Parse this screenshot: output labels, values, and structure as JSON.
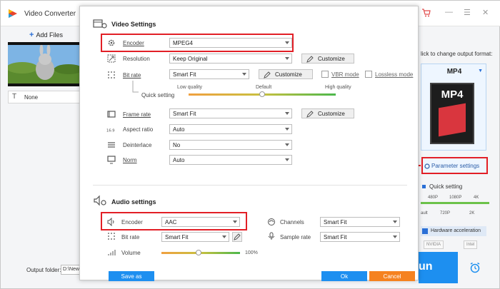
{
  "app": {
    "title": "Video Converter",
    "add_files": "Add Files",
    "file_item": "None",
    "output_folder_label": "Output folder:",
    "output_folder_value": "D:\\New fo"
  },
  "right_panel": {
    "hint": "lick to change output format:",
    "format": "MP4",
    "format_box_text": "MP4",
    "parameter_settings": "Parameter settings",
    "quick_setting": "Quick setting",
    "res_top": [
      "480P",
      "1080P",
      "4K"
    ],
    "res_bottom": [
      "ault",
      "720P",
      "2K"
    ],
    "hw_accel": "Hardware acceleration",
    "gpu_badges": [
      "NVIDIA",
      "Intel"
    ],
    "run": "un"
  },
  "video": {
    "title": "Video Settings",
    "encoder_label": "Encoder",
    "encoder_value": "MPEG4",
    "resolution_label": "Resolution",
    "resolution_value": "Keep Original",
    "customize": "Customize",
    "bitrate_label": "Bit rate",
    "bitrate_value": "Smart Fit",
    "vbr_mode": "VBR mode",
    "lossless_mode": "Lossless mode",
    "quick_setting": "Quick setting",
    "quality_low": "Low quality",
    "quality_default": "Default",
    "quality_high": "High quality",
    "quality_level": 0.5,
    "framerate_label": "Frame rate",
    "framerate_value": "Smart Fit",
    "aspect_label": "Aspect ratio",
    "aspect_value": "Auto",
    "deinterlace_label": "Deinterlace",
    "deinterlace_value": "No",
    "norm_label": "Norm",
    "norm_value": "Auto"
  },
  "audio": {
    "title": "Audio settings",
    "encoder_label": "Encoder",
    "encoder_value": "AAC",
    "bitrate_label": "Bit rate",
    "bitrate_value": "Smart Fit",
    "channels_label": "Channels",
    "channels_value": "Smart Fit",
    "samplerate_label": "Sample rate",
    "samplerate_value": "Smart Fit",
    "volume_label": "Volume",
    "volume_value": "100%",
    "volume_level": 0.47
  },
  "buttons": {
    "save_as": "Save as",
    "ok": "Ok",
    "cancel": "Cancel"
  },
  "colors": {
    "accent": "#1d8ff0",
    "highlight": "#e21f26",
    "cancel": "#f58220"
  }
}
